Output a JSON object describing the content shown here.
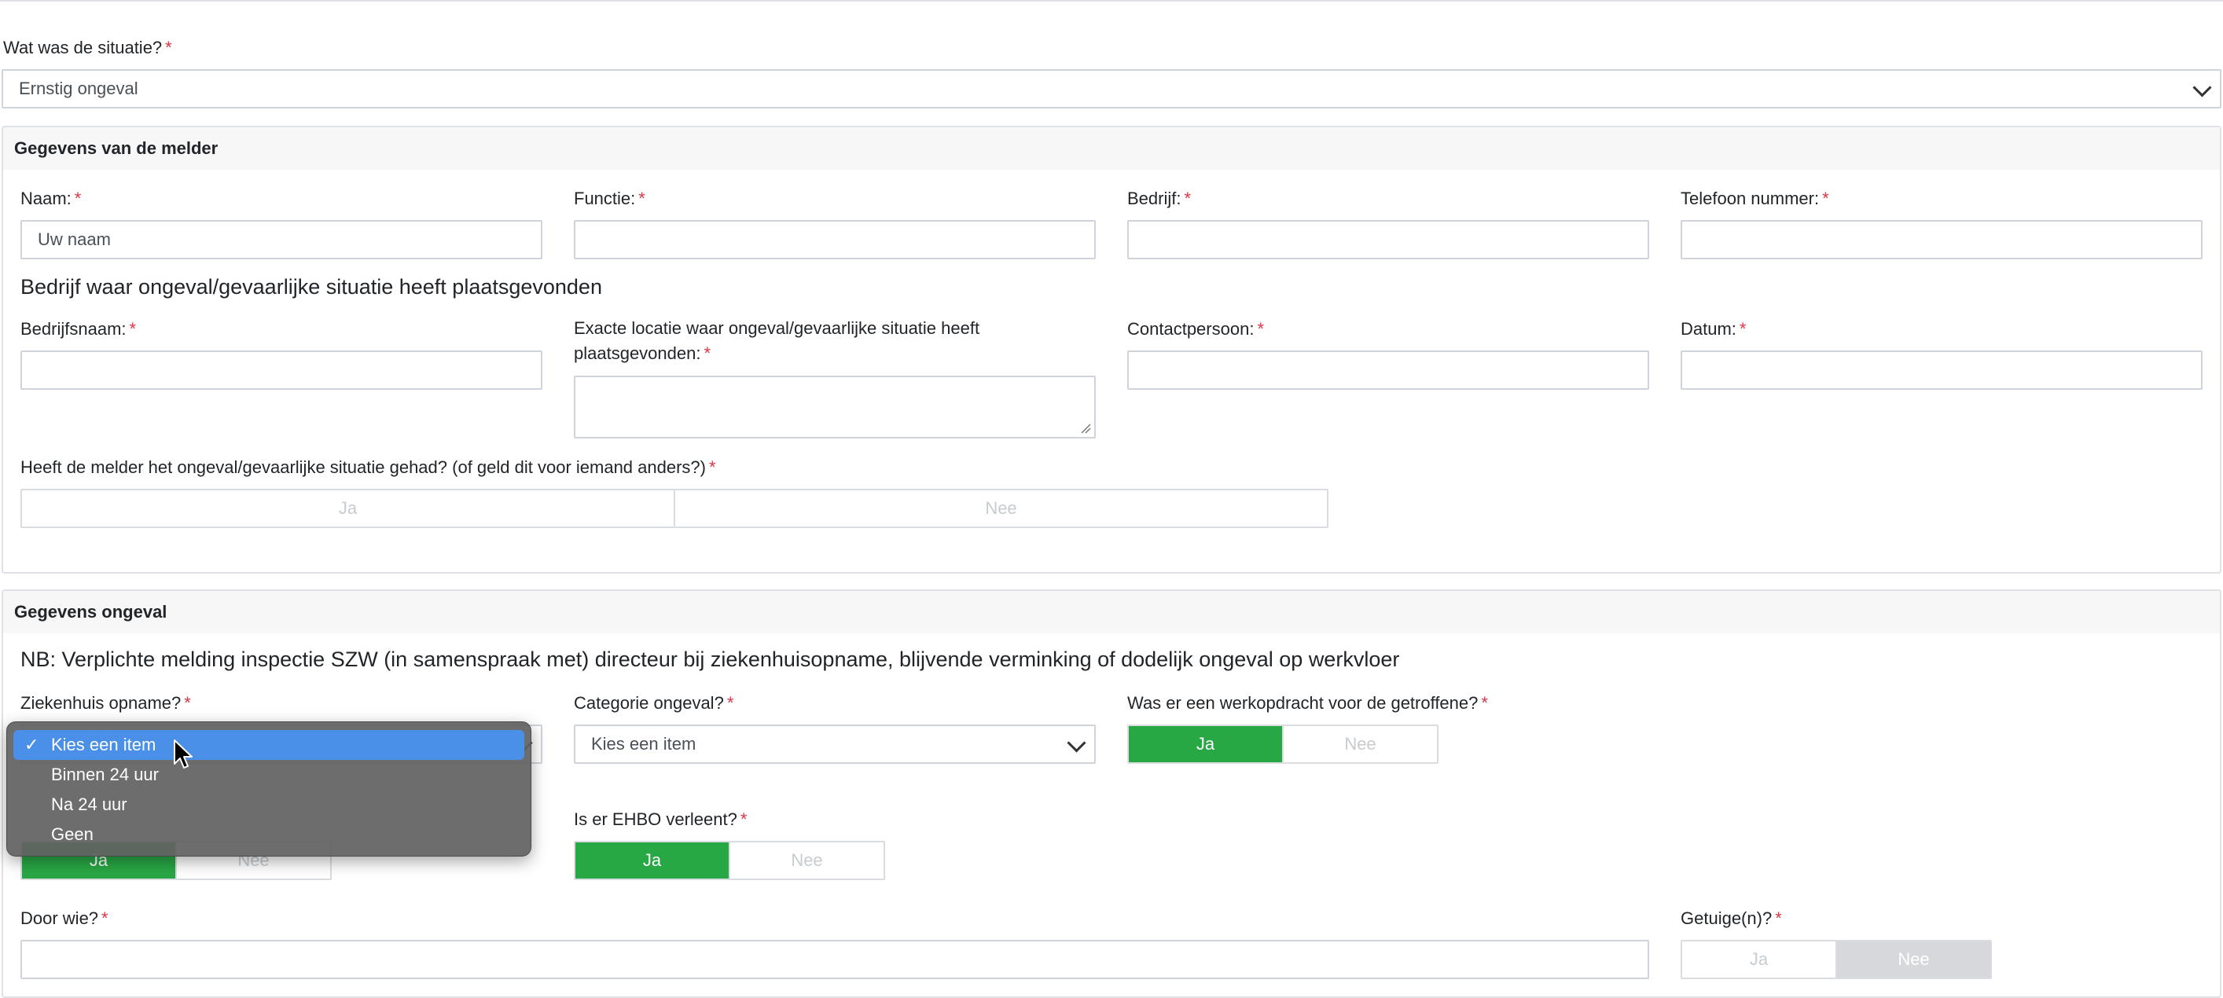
{
  "situatie": {
    "label": "Wat was de situatie?",
    "req": "*",
    "value": "Ernstig ongeval"
  },
  "melder": {
    "title": "Gegevens van de melder",
    "naam": {
      "label": "Naam:",
      "req": "*",
      "placeholder": "Uw naam"
    },
    "functie": {
      "label": "Functie:",
      "req": "*"
    },
    "bedrijf": {
      "label": "Bedrijf:",
      "req": "*"
    },
    "telefoon": {
      "label": "Telefoon nummer:",
      "req": "*"
    },
    "subtitle": "Bedrijf waar ongeval/gevaarlijke situatie heeft plaatsgevonden",
    "bedrijfsnaam": {
      "label": "Bedrijfsnaam:",
      "req": "*"
    },
    "locatie": {
      "label": "Exacte locatie waar ongeval/gevaarlijke situatie heeft plaatsgevonden:",
      "req": "*"
    },
    "contactpersoon": {
      "label": "Contactpersoon:",
      "req": "*"
    },
    "datum": {
      "label": "Datum:",
      "req": "*"
    },
    "zelf": {
      "label": "Heeft de melder het ongeval/gevaarlijke situatie gehad? (of geld dit voor iemand anders?)",
      "req": "*",
      "ja": "Ja",
      "nee": "Nee"
    }
  },
  "ongeval": {
    "title": "Gegevens ongeval",
    "notice": "NB: Verplichte melding inspectie SZW (in samenspraak met) directeur bij ziekenhuisopname, blijvende verminking of dodelijk ongeval op werkvloer",
    "ziekenhuis": {
      "label": "Ziekenhuis opname?",
      "req": "*"
    },
    "categorie": {
      "label": "Categorie ongeval?",
      "req": "*",
      "value": "Kies een item"
    },
    "werkopdracht": {
      "label": "Was er een werkopdracht voor de getroffene?",
      "req": "*",
      "ja": "Ja",
      "nee": "Nee"
    },
    "hidden_toggle": {
      "ja": "Ja",
      "nee": "Nee"
    },
    "ehbo": {
      "label": "Is er EHBO verleent?",
      "req": "*",
      "ja": "Ja",
      "nee": "Nee"
    },
    "doorwie": {
      "label": "Door wie?",
      "req": "*"
    },
    "getuige": {
      "label": "Getuige(n)?",
      "req": "*",
      "ja": "Ja",
      "nee": "Nee"
    }
  },
  "dropdown": {
    "check": "✓",
    "items": [
      "Kies een item",
      "Binnen 24 uur",
      "Na 24 uur",
      "Geen"
    ]
  },
  "colors": {
    "accent_green": "#28a745",
    "required_red": "#dc3545",
    "dropdown_highlight": "#4a8fe8"
  }
}
